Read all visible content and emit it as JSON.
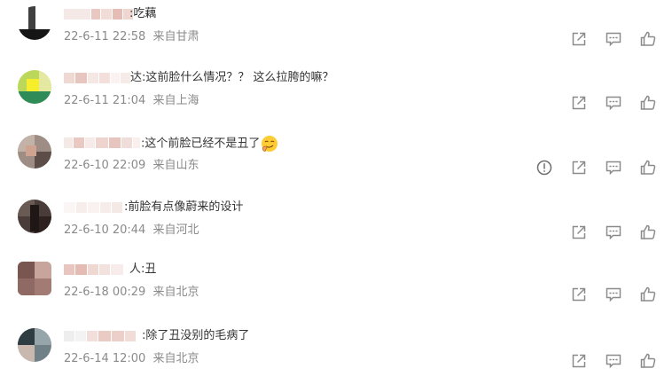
{
  "comments": [
    {
      "text": ":吃藕",
      "time": "22-6-11 22:58",
      "location": "来自甘肃",
      "has_report": false
    },
    {
      "text": "达:这前脸什么情况？？ 这么拉胯的嘛？",
      "time": "22-6-11 21:04",
      "location": "来自上海",
      "has_report": false
    },
    {
      "text": ":这个前脸已经不是丑了",
      "time": "22-6-10 22:09",
      "location": "来自山东",
      "has_report": true
    },
    {
      "text": ":前脸有点像蔚来的设计",
      "time": "22-6-10 20:44",
      "location": "来自河北",
      "has_report": false
    },
    {
      "text": "人:丑",
      "time": "22-6-18 00:29",
      "location": "来自北京",
      "has_report": false
    },
    {
      "text": ":除了丑没别的毛病了",
      "time": "22-6-14 12:00",
      "location": "来自北京",
      "has_report": false
    }
  ],
  "icons": {
    "report": "report-icon",
    "share": "share-icon",
    "reply": "comment-icon",
    "like": "thumb-up-icon"
  },
  "colors": {
    "text": "#333333",
    "meta": "#8a8a8a",
    "icon": "#8b8b8b"
  }
}
